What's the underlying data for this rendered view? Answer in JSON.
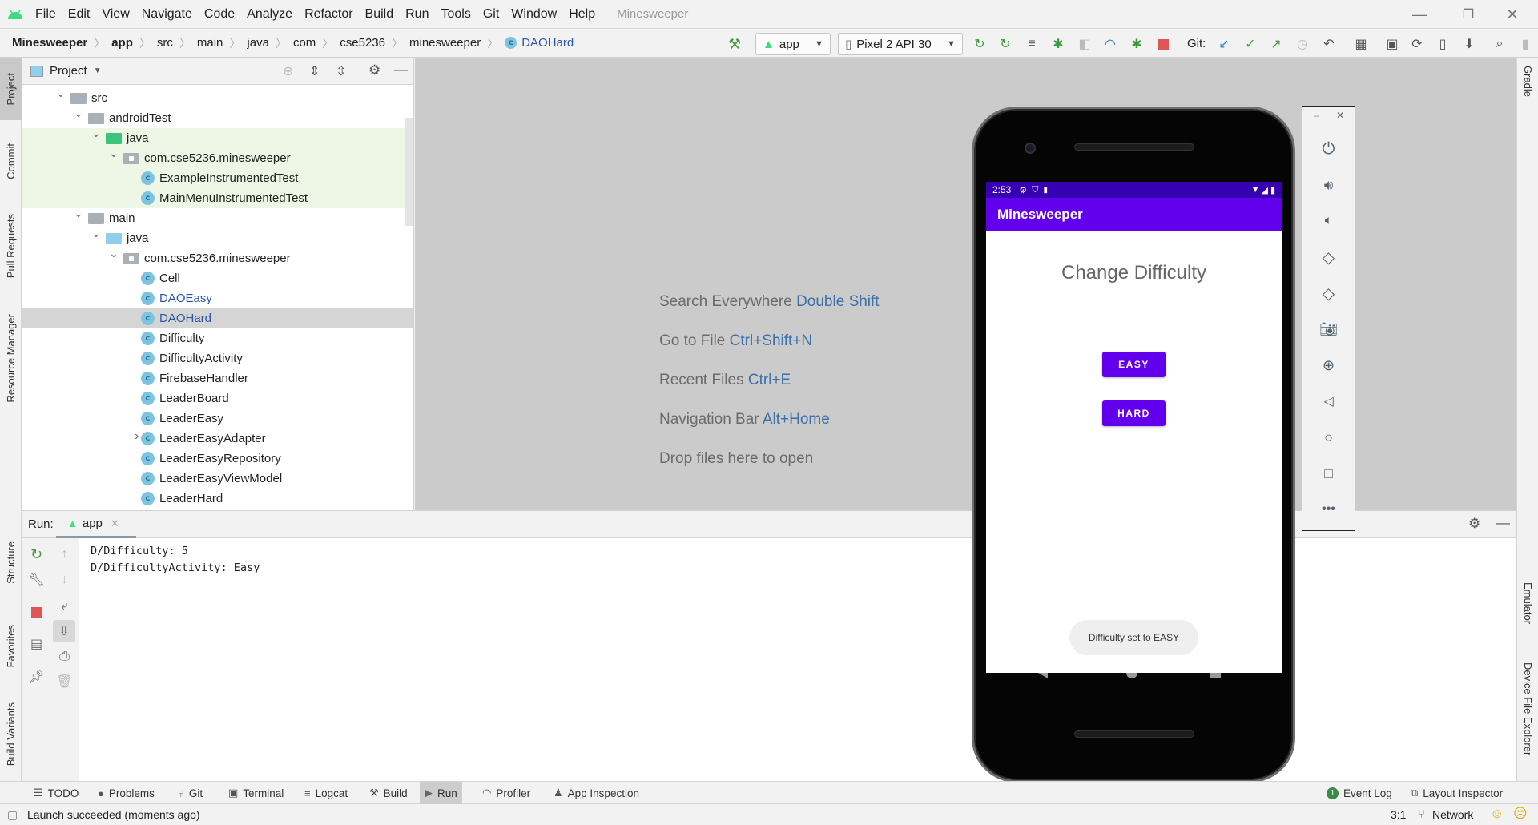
{
  "window": {
    "title": "Minesweeper",
    "menu": [
      "File",
      "Edit",
      "View",
      "Navigate",
      "Code",
      "Analyze",
      "Refactor",
      "Build",
      "Run",
      "Tools",
      "Git",
      "Window",
      "Help"
    ],
    "controls": {
      "minimize": "—",
      "restore": "❐",
      "close": "✕"
    }
  },
  "breadcrumb": [
    "Minesweeper",
    "app",
    "src",
    "main",
    "java",
    "com",
    "cse5236",
    "minesweeper",
    "DAOHard"
  ],
  "toolbar": {
    "run_config": "app",
    "device": "Pixel 2 API 30",
    "git_label": "Git:"
  },
  "left_tool_windows": [
    "Project",
    "Commit",
    "Pull Requests",
    "Resource Manager",
    "Structure",
    "Favorites",
    "Build Variants"
  ],
  "right_tool_windows": [
    "Gradle",
    "Emulator",
    "Device File Explorer"
  ],
  "project_panel": {
    "title": "Project",
    "tree": [
      {
        "label": "src",
        "type": "folder",
        "expanded": true
      },
      {
        "label": "androidTest",
        "type": "folder",
        "expanded": true
      },
      {
        "label": "java",
        "type": "test-source-folder",
        "expanded": true
      },
      {
        "label": "com.cse5236.minesweeper",
        "type": "package",
        "expanded": true
      },
      {
        "label": "ExampleInstrumentedTest",
        "type": "test-class"
      },
      {
        "label": "MainMenuInstrumentedTest",
        "type": "test-class"
      },
      {
        "label": "main",
        "type": "folder",
        "expanded": true
      },
      {
        "label": "java",
        "type": "source-folder",
        "expanded": true
      },
      {
        "label": "com.cse5236.minesweeper",
        "type": "package",
        "expanded": true
      },
      {
        "label": "Cell",
        "type": "class"
      },
      {
        "label": "DAOEasy",
        "type": "class",
        "modified": true
      },
      {
        "label": "DAOHard",
        "type": "class",
        "modified": true,
        "selected": true
      },
      {
        "label": "Difficulty",
        "type": "class"
      },
      {
        "label": "DifficultyActivity",
        "type": "class"
      },
      {
        "label": "FirebaseHandler",
        "type": "class"
      },
      {
        "label": "LeaderBoard",
        "type": "class"
      },
      {
        "label": "LeaderEasy",
        "type": "class"
      },
      {
        "label": "LeaderEasyAdapter",
        "type": "class",
        "collapsed": true
      },
      {
        "label": "LeaderEasyRepository",
        "type": "class"
      },
      {
        "label": "LeaderEasyViewModel",
        "type": "class"
      },
      {
        "label": "LeaderHard",
        "type": "class"
      }
    ]
  },
  "editor_hints": [
    {
      "text": "Search Everywhere",
      "key": "Double Shift"
    },
    {
      "text": "Go to File",
      "key": "Ctrl+Shift+N"
    },
    {
      "text": "Recent Files",
      "key": "Ctrl+E"
    },
    {
      "text": "Navigation Bar",
      "key": "Alt+Home"
    },
    {
      "text": "Drop files here to open",
      "key": ""
    }
  ],
  "run_panel": {
    "label": "Run:",
    "tab": "app",
    "console": [
      "D/Difficulty: 5",
      "D/DifficultyActivity: Easy"
    ]
  },
  "bottom_tabs": [
    "TODO",
    "Problems",
    "Git",
    "Terminal",
    "Logcat",
    "Build",
    "Run",
    "Profiler",
    "App Inspection"
  ],
  "bottom_right_tabs": {
    "event_log": "Event Log",
    "event_count": "1",
    "layout_inspector": "Layout Inspector"
  },
  "status": {
    "message": "Launch succeeded (moments ago)",
    "position": "3:1",
    "branch": "Network"
  },
  "emulator": {
    "status_time": "2:53",
    "app_title": "Minesweeper",
    "heading": "Change Difficulty",
    "buttons": [
      "EASY",
      "HARD"
    ],
    "toast": "Difficulty set to EASY",
    "colors": {
      "primary": "#6200ee",
      "primary_dark": "#3700b3"
    },
    "side_controls": [
      "power",
      "volume-up",
      "volume-down",
      "rotate-left",
      "rotate-right",
      "screenshot",
      "zoom",
      "back",
      "home",
      "overview",
      "more"
    ]
  }
}
